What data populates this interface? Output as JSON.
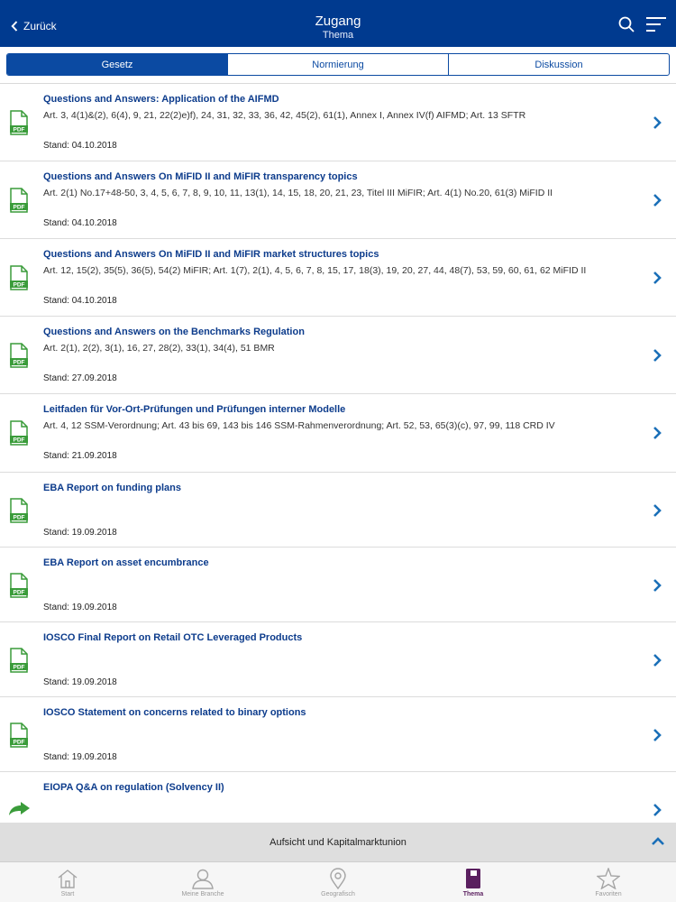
{
  "header": {
    "back_label": "Zurück",
    "title": "Zugang",
    "subtitle": "Thema"
  },
  "segments": [
    {
      "label": "Gesetz",
      "active": true
    },
    {
      "label": "Normierung",
      "active": false
    },
    {
      "label": "Diskussion",
      "active": false
    }
  ],
  "items": [
    {
      "title": "Questions and Answers: Application of the AIFMD",
      "articles": "Art. 3, 4(1)&(2), 6(4), 9, 21, 22(2)e)f), 24, 31, 32, 33, 36, 42, 45(2), 61(1), Annex I, Annex IV(f) AIFMD; Art. 13 SFTR",
      "date": "Stand: 04.10.2018",
      "icon": "pdf-icon"
    },
    {
      "title": "Questions and Answers On MiFID II and MiFIR transparency topics",
      "articles": "Art. 2(1) No.17+48-50, 3, 4, 5, 6, 7, 8, 9, 10, 11, 13(1), 14, 15, 18, 20, 21, 23, Titel III MiFIR; Art. 4(1) No.20, 61(3) MiFID II",
      "date": "Stand: 04.10.2018",
      "icon": "pdf-icon"
    },
    {
      "title": "Questions and Answers On MiFID II and MiFIR market structures topics",
      "articles": "Art. 12, 15(2), 35(5), 36(5), 54(2) MiFIR; Art. 1(7), 2(1), 4, 5, 6, 7, 8, 15, 17, 18(3), 19, 20, 27, 44, 48(7), 53, 59, 60, 61, 62 MiFID II",
      "date": "Stand: 04.10.2018",
      "icon": "pdf-icon"
    },
    {
      "title": "Questions and Answers on the Benchmarks Regulation",
      "articles": "Art. 2(1), 2(2), 3(1), 16, 27, 28(2), 33(1), 34(4), 51 BMR",
      "date": "Stand: 27.09.2018",
      "icon": "pdf-icon"
    },
    {
      "title": "Leitfaden für Vor-Ort-Prüfungen und Prüfungen interner Modelle",
      "articles": "Art. 4, 12 SSM-Verordnung; Art. 43 bis 69, 143 bis 146 SSM-Rahmenverordnung; Art. 52, 53, 65(3)(c), 97, 99, 118 CRD IV",
      "date": "Stand: 21.09.2018",
      "icon": "pdf-icon"
    },
    {
      "title": "EBA Report on funding plans",
      "articles": "",
      "date": "Stand: 19.09.2018",
      "icon": "pdf-icon"
    },
    {
      "title": "EBA Report on asset encumbrance",
      "articles": "",
      "date": "Stand: 19.09.2018",
      "icon": "pdf-icon"
    },
    {
      "title": "IOSCO Final Report on Retail OTC Leveraged Products",
      "articles": "",
      "date": "Stand: 19.09.2018",
      "icon": "pdf-icon"
    },
    {
      "title": "IOSCO Statement on concerns related to binary options",
      "articles": "",
      "date": "Stand: 19.09.2018",
      "icon": "pdf-icon"
    },
    {
      "title": "EIOPA Q&A on regulation (Solvency II)",
      "articles": "",
      "date": "",
      "icon": "link-arrow-icon"
    }
  ],
  "section_bar": {
    "label": "Aufsicht und Kapitalmarktunion"
  },
  "tabs": [
    {
      "label": "Start",
      "icon": "home-icon",
      "active": false
    },
    {
      "label": "Meine Branche",
      "icon": "person-icon",
      "active": false
    },
    {
      "label": "Geografisch",
      "icon": "location-pin-icon",
      "active": false
    },
    {
      "label": "Thema",
      "icon": "book-icon",
      "active": true
    },
    {
      "label": "Favoriten",
      "icon": "star-icon",
      "active": false
    }
  ],
  "colors": {
    "header_bg": "#003a8f",
    "accent": "#0b4aa2",
    "title_text": "#0d3c8c",
    "pdf_green": "#3a9c3a",
    "active_tab": "#5a1f5f"
  }
}
